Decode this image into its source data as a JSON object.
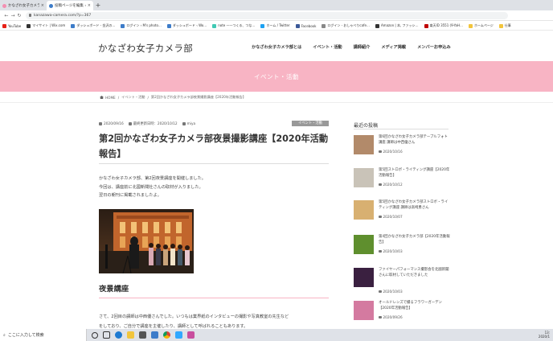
{
  "browser": {
    "tabs": [
      {
        "title": "かなざわ女子カメラ部夜景撮影講…",
        "active": false
      },
      {
        "title": "投稿ページを編集 ‹ M's photograp…",
        "active": true
      }
    ],
    "url": "kanazawa-camera.com/?p=367",
    "bookmarks": [
      {
        "label": "YouTube",
        "color": "#e62117"
      },
      {
        "label": "マイサイト | Wix.com",
        "color": "#333333"
      },
      {
        "label": "ダッシュボード - 金沢の…",
        "color": "#3d7cc9"
      },
      {
        "label": "ログイン ‹ M's photo…",
        "color": "#3d7cc9"
      },
      {
        "label": "ダッシュボード ‹ Wo…",
        "color": "#3d7cc9"
      },
      {
        "label": "note ——つくる、つな…",
        "color": "#41c9b4"
      },
      {
        "label": "ホーム / Twitter",
        "color": "#1da1f2"
      },
      {
        "label": "Facebook",
        "color": "#3b5998"
      },
      {
        "label": "ログイン - おしゃべりcafe…",
        "color": "#888888"
      },
      {
        "label": "Amazon | 本, ファッシ…",
        "color": "#333333"
      },
      {
        "label": "楽天ID 3551 (9-YaH…",
        "color": "#bf0000"
      },
      {
        "label": "ホームページ",
        "color": "#f2c53d"
      },
      {
        "label": "仕事",
        "color": "#f2c53d"
      }
    ]
  },
  "site": {
    "title": "かなざわ女子カメラ部",
    "nav": [
      "かなざわ女子カメラ部とは",
      "イベント・活動",
      "講師紹介",
      "メディア掲載",
      "メンバーお申込み"
    ],
    "band_title": "イベント・活動"
  },
  "breadcrumb": {
    "home": "HOME",
    "items": [
      "イベント・活動",
      "第2回かなざわ女子カメラ部夜景撮影講座【2020年活動報告】"
    ]
  },
  "post": {
    "date": "2020/09/16",
    "updated_label": "最終更新日時：2020/10/12",
    "author": "miya",
    "category": "イベント・活動",
    "title": "第2回かなざわ女子カメラ部夜景撮影講座【2020年活動報告】",
    "paragraphs": [
      "かなざわ女子カメラ部、第2回夜景講座を開催しました。",
      "今回は、講座前に北國新聞社さんの取材が入りました。",
      "翌日の朝刊に掲載されましたよ。"
    ],
    "heading2": "夜景講座",
    "paragraph2": "さて、2回目の講師は中西優さんでした。いつもは業界紙のインタビューの撮影や写真教室の先生など",
    "paragraph3": "をしており、ご自分で講座を主催したり、講師として呼ばれることもあります。"
  },
  "sidebar": {
    "heading": "最近の投稿",
    "items": [
      {
        "title": "第6回かなざわ女子カメラ部テーブルフォト講座 講師は中西優さん",
        "date": "2020/10/16",
        "color": "#b28a6a"
      },
      {
        "title": "第5回ストロボ・ライティング講座【2020年活動報告】",
        "date": "2020/10/12",
        "color": "#c9c3b8"
      },
      {
        "title": "第5回かなざわ女子カメラ部ストロボ・ライティング講座 講師は高崎勇さん",
        "date": "2020/10/07",
        "color": "#d8b071"
      },
      {
        "title": "第4回かなざわ女子カメラ部【2020年活動報告】",
        "date": "2020/10/03",
        "color": "#5f8f2e"
      },
      {
        "title": "ファイヤーパフォーマンス撮影会を北國新聞さんに取材していただきました",
        "date": "2020/10/03",
        "color": "#3a2040"
      },
      {
        "title": "オールドレンズで撮るフラワーガーデン【2020年活動報告】",
        "date": "2020/09/26",
        "color": "#d47aa0"
      }
    ]
  },
  "taskbar": {
    "search_placeholder": "ここに入力して検索",
    "time": "13:",
    "date": "2020/1"
  }
}
